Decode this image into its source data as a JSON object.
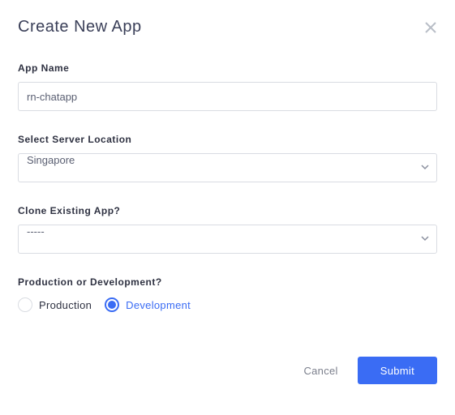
{
  "header": {
    "title": "Create New App"
  },
  "fields": {
    "appName": {
      "label": "App Name",
      "value": "rn-chatapp"
    },
    "serverLocation": {
      "label": "Select Server Location",
      "value": "Singapore"
    },
    "cloneExisting": {
      "label": "Clone Existing App?",
      "value": "-----"
    },
    "envMode": {
      "label": "Production or Development?",
      "options": {
        "production": "Production",
        "development": "Development"
      },
      "selected": "development"
    }
  },
  "footer": {
    "cancel": "Cancel",
    "submit": "Submit"
  }
}
